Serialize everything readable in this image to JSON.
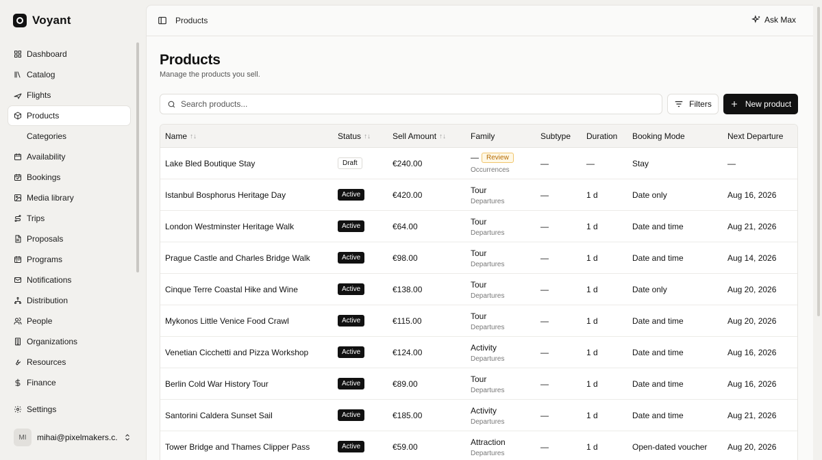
{
  "brand": {
    "name": "Voyant"
  },
  "sidebar": {
    "items": [
      {
        "label": "Dashboard",
        "icon": "dashboard-icon"
      },
      {
        "label": "Catalog",
        "icon": "library-icon"
      },
      {
        "label": "Flights",
        "icon": "plane-icon"
      },
      {
        "label": "Products",
        "icon": "package-icon",
        "active": true
      },
      {
        "label": "Categories",
        "icon": "",
        "sub": true
      },
      {
        "label": "Availability",
        "icon": "calendar-icon"
      },
      {
        "label": "Bookings",
        "icon": "calendar-check-icon"
      },
      {
        "label": "Media library",
        "icon": "images-icon"
      },
      {
        "label": "Trips",
        "icon": "route-icon"
      },
      {
        "label": "Proposals",
        "icon": "file-text-icon"
      },
      {
        "label": "Programs",
        "icon": "calendar-days-icon"
      },
      {
        "label": "Notifications",
        "icon": "mail-icon"
      },
      {
        "label": "Distribution",
        "icon": "network-icon"
      },
      {
        "label": "People",
        "icon": "users-icon"
      },
      {
        "label": "Organizations",
        "icon": "building-icon"
      },
      {
        "label": "Resources",
        "icon": "wrench-icon"
      },
      {
        "label": "Finance",
        "icon": "dollar-icon"
      }
    ],
    "settings_label": "Settings"
  },
  "user": {
    "initials": "MI",
    "email": "mihai@pixelmakers.c..."
  },
  "topbar": {
    "breadcrumb": "Products",
    "ask_label": "Ask Max"
  },
  "page": {
    "title": "Products",
    "subtitle": "Manage the products you sell."
  },
  "search": {
    "placeholder": "Search products..."
  },
  "toolbar": {
    "filters_label": "Filters",
    "new_label": "New product"
  },
  "table": {
    "columns": [
      "Name",
      "Status",
      "Sell Amount",
      "Family",
      "Subtype",
      "Duration",
      "Booking Mode",
      "Next Departure"
    ],
    "rows": [
      {
        "name": "Lake Bled Boutique Stay",
        "status": "Draft",
        "amount": "€240.00",
        "family": "—",
        "family_sub": "Occurrences",
        "review": "Review",
        "subtype": "—",
        "duration": "—",
        "mode": "Stay",
        "next": "—"
      },
      {
        "name": "Istanbul Bosphorus Heritage Day",
        "status": "Active",
        "amount": "€420.00",
        "family": "Tour",
        "family_sub": "Departures",
        "subtype": "—",
        "duration": "1 d",
        "mode": "Date only",
        "next": "Aug 16, 2026"
      },
      {
        "name": "London Westminster Heritage Walk",
        "status": "Active",
        "amount": "€64.00",
        "family": "Tour",
        "family_sub": "Departures",
        "subtype": "—",
        "duration": "1 d",
        "mode": "Date and time",
        "next": "Aug 21, 2026"
      },
      {
        "name": "Prague Castle and Charles Bridge Walk",
        "status": "Active",
        "amount": "€98.00",
        "family": "Tour",
        "family_sub": "Departures",
        "subtype": "—",
        "duration": "1 d",
        "mode": "Date and time",
        "next": "Aug 14, 2026"
      },
      {
        "name": "Cinque Terre Coastal Hike and Wine",
        "status": "Active",
        "amount": "€138.00",
        "family": "Tour",
        "family_sub": "Departures",
        "subtype": "—",
        "duration": "1 d",
        "mode": "Date only",
        "next": "Aug 20, 2026"
      },
      {
        "name": "Mykonos Little Venice Food Crawl",
        "status": "Active",
        "amount": "€115.00",
        "family": "Tour",
        "family_sub": "Departures",
        "subtype": "—",
        "duration": "1 d",
        "mode": "Date and time",
        "next": "Aug 20, 2026"
      },
      {
        "name": "Venetian Cicchetti and Pizza Workshop",
        "status": "Active",
        "amount": "€124.00",
        "family": "Activity",
        "family_sub": "Departures",
        "subtype": "—",
        "duration": "1 d",
        "mode": "Date and time",
        "next": "Aug 16, 2026"
      },
      {
        "name": "Berlin Cold War History Tour",
        "status": "Active",
        "amount": "€89.00",
        "family": "Tour",
        "family_sub": "Departures",
        "subtype": "—",
        "duration": "1 d",
        "mode": "Date and time",
        "next": "Aug 16, 2026"
      },
      {
        "name": "Santorini Caldera Sunset Sail",
        "status": "Active",
        "amount": "€185.00",
        "family": "Activity",
        "family_sub": "Departures",
        "subtype": "—",
        "duration": "1 d",
        "mode": "Date and time",
        "next": "Aug 21, 2026"
      },
      {
        "name": "Tower Bridge and Thames Clipper Pass",
        "status": "Active",
        "amount": "€59.00",
        "family": "Attraction",
        "family_sub": "Departures",
        "subtype": "—",
        "duration": "1 d",
        "mode": "Open-dated voucher",
        "next": "Aug 20, 2026"
      }
    ]
  },
  "colors": {
    "accent": "#111111",
    "review": "#b46a00",
    "background": "#f2f1ee"
  }
}
